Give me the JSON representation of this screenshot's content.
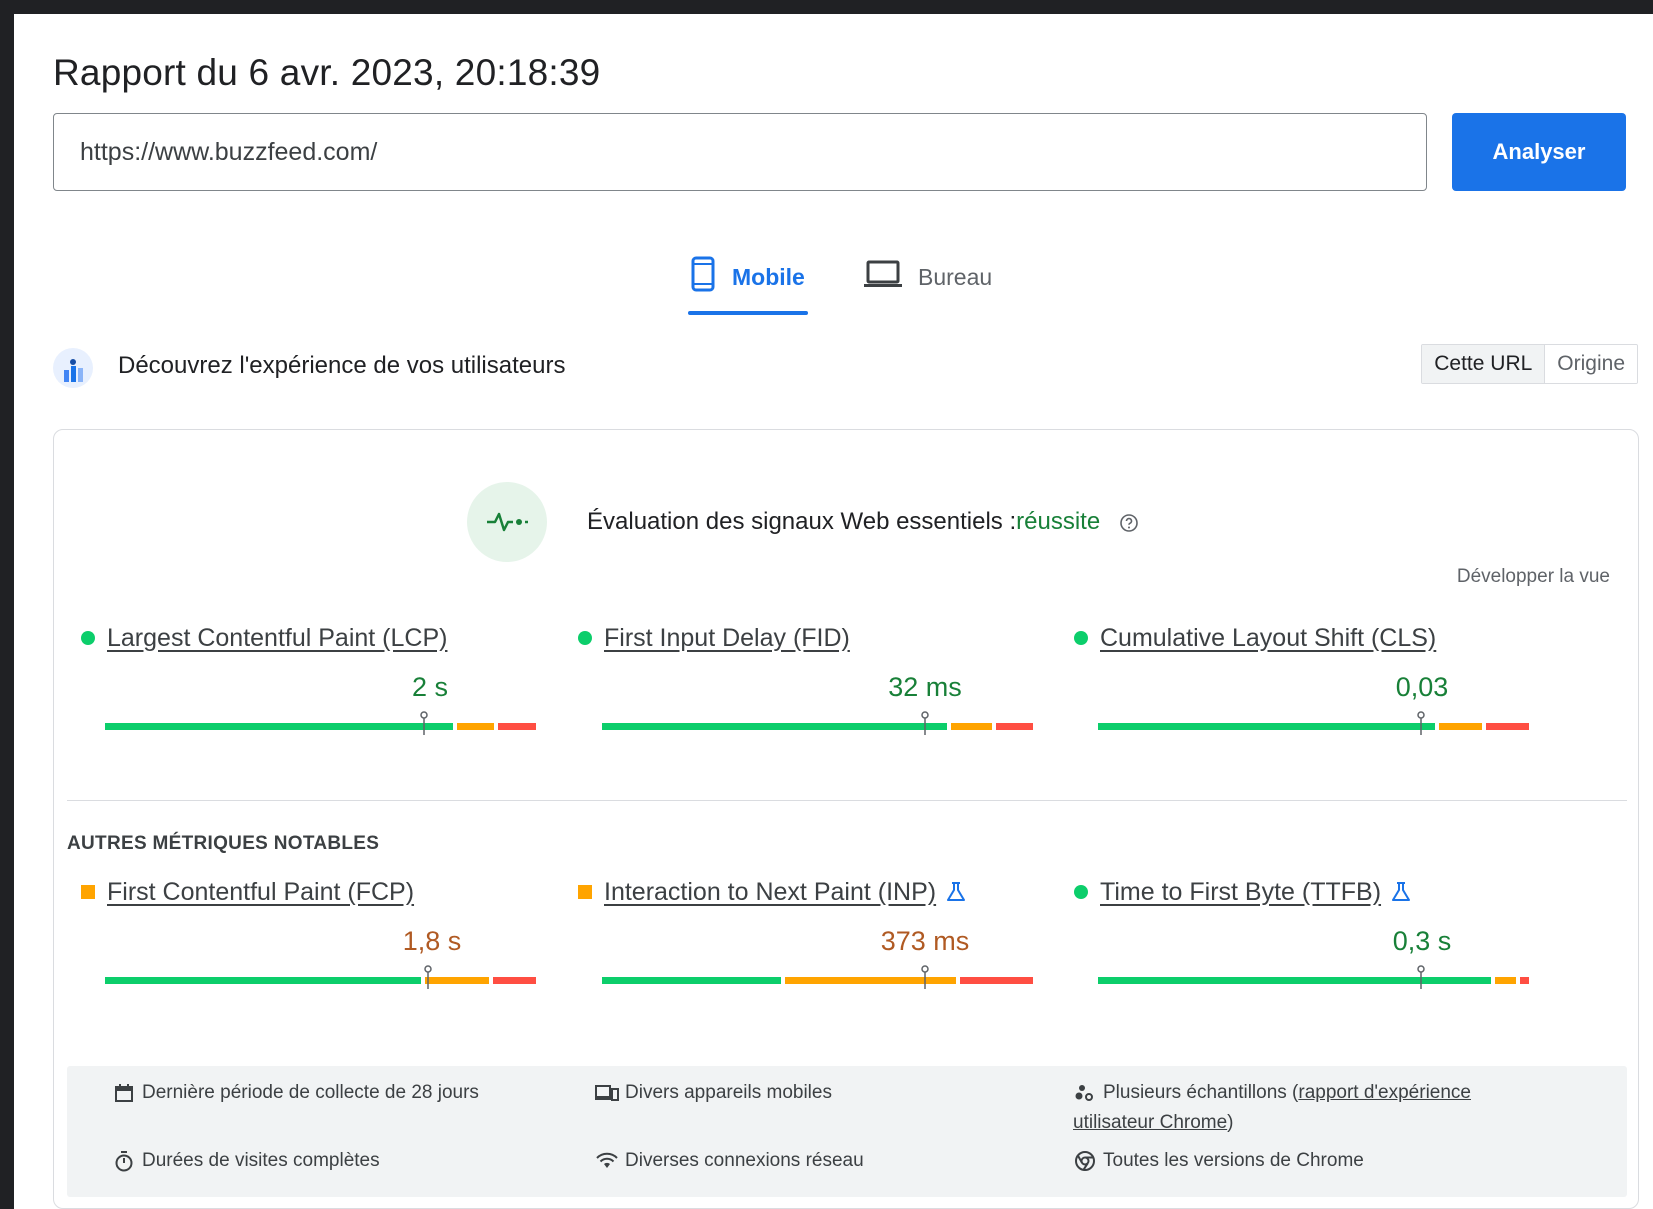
{
  "report": {
    "title": "Rapport du 6 avr. 2023, 20:18:39"
  },
  "search": {
    "url_value": "https://www.buzzfeed.com/",
    "analyze_label": "Analyser"
  },
  "tabs": [
    {
      "label": "Mobile",
      "icon": "smartphone-icon",
      "active": true
    },
    {
      "label": "Bureau",
      "icon": "laptop-icon",
      "active": false
    }
  ],
  "field_data": {
    "title": "Découvrez l'expérience de vos utilisateurs",
    "toggle": [
      "Cette URL",
      "Origine"
    ],
    "assessment_label": "Évaluation des signaux Web essentiels :",
    "assessment_status": "réussite",
    "expand_label": "Développer la vue",
    "other_metrics_label": "AUTRES MÉTRIQUES NOTABLES"
  },
  "metrics": {
    "lcp": {
      "name": "Largest Contentful Paint (LCP)",
      "value": "2 s",
      "status": "good",
      "distribution": [
        0.74,
        0.08,
        0.08
      ],
      "p75_fraction": 0.74
    },
    "fid": {
      "name": "First Input Delay (FID)",
      "value": "32 ms",
      "status": "good",
      "distribution": [
        0.75,
        0.09,
        0.08
      ],
      "p75_fraction": 0.75
    },
    "cls": {
      "name": "Cumulative Layout Shift (CLS)",
      "value": "0,03",
      "status": "good",
      "distribution": [
        0.78,
        0.1,
        0.1
      ],
      "p75_fraction": 0.75
    },
    "fcp": {
      "name": "First Contentful Paint (FCP)",
      "value": "1,8 s",
      "status": "average",
      "distribution": [
        0.74,
        0.15,
        0.1
      ],
      "p75_fraction": 0.75
    },
    "inp": {
      "name": "Interaction to Next Paint (INP)",
      "value": "373 ms",
      "status": "average",
      "distribution": [
        0.42,
        0.4,
        0.17
      ],
      "p75_fraction": 0.75
    },
    "ttfb": {
      "name": "Time to First Byte (TTFB)",
      "value": "0,3 s",
      "status": "good",
      "distribution": [
        0.92,
        0.05,
        0.02
      ],
      "p75_fraction": 0.75
    }
  },
  "footer": {
    "period": "Dernière période de collecte de 28 jours",
    "devices": "Divers appareils mobiles",
    "samples_prefix": "Plusieurs échantillons (",
    "samples_link": "rapport d'expérience utilisateur Chrome",
    "samples_suffix": ")",
    "durations": "Durées de visites complètes",
    "connections": "Diverses connexions réseau",
    "chrome_versions": "Toutes les versions de Chrome"
  },
  "colors": {
    "accent": "#1a73e8",
    "good": "#0cce6b",
    "average": "#ffa400",
    "poor": "#ff4e42"
  }
}
